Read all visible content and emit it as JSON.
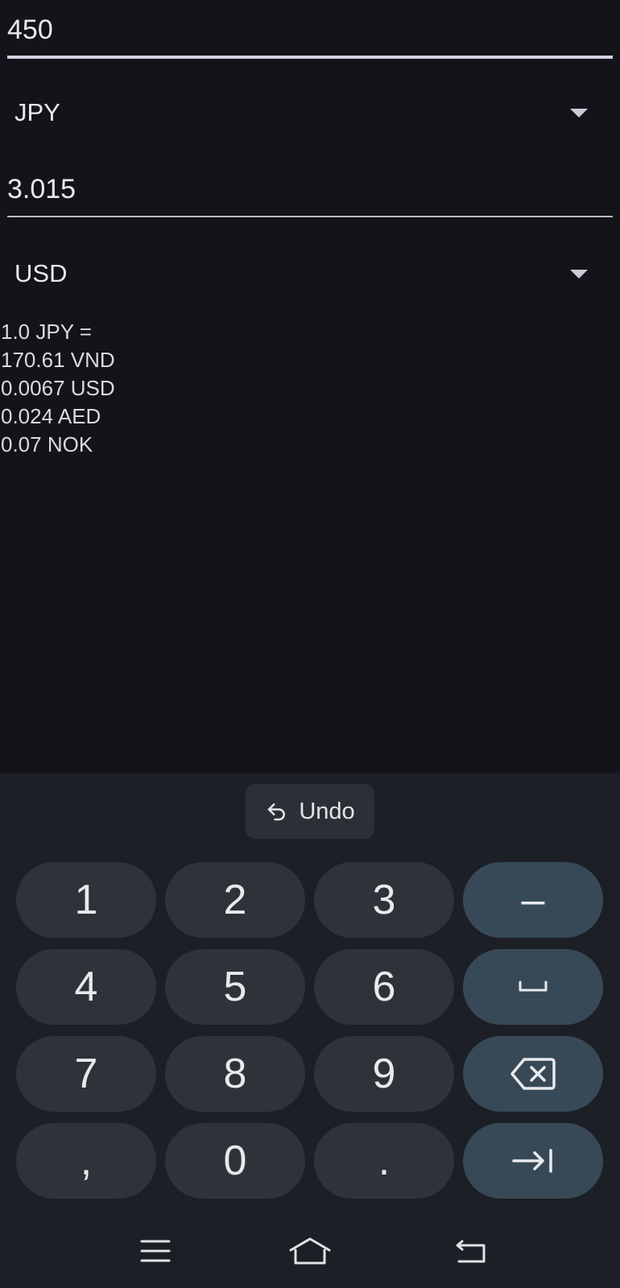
{
  "amount_field": {
    "value": "450"
  },
  "from_currency": {
    "selected": "JPY"
  },
  "result_field": {
    "value": "3.015"
  },
  "to_currency": {
    "selected": "USD"
  },
  "rates": {
    "header": "1.0 JPY =",
    "lines": [
      "170.61 VND",
      "0.0067 USD",
      "0.024 AED",
      "0.07 NOK"
    ]
  },
  "keyboard": {
    "undo_label": "Undo",
    "keys": {
      "k1": "1",
      "k2": "2",
      "k3": "3",
      "minus": "–",
      "k4": "4",
      "k5": "5",
      "k6": "6",
      "k7": "7",
      "k8": "8",
      "k9": "9",
      "comma": ",",
      "k0": "0",
      "period": "."
    },
    "icons": {
      "space": "space-icon",
      "backspace": "backspace-icon",
      "next": "tab-next-icon"
    }
  },
  "navbar": {
    "icons": [
      "menu-icon",
      "home-icon",
      "back-icon"
    ]
  },
  "colors": {
    "background": "#15131a",
    "keyboard_bg": "#1c1f25",
    "key_bg": "#2e333a",
    "func_key_bg": "#374956"
  }
}
